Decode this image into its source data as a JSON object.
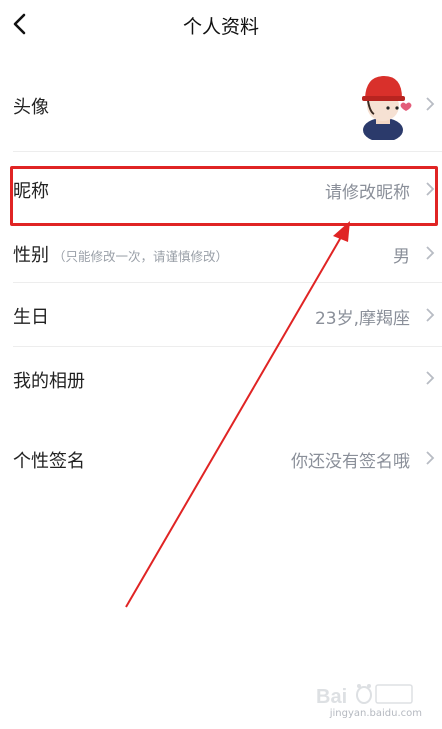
{
  "header": {
    "title": "个人资料"
  },
  "rows": {
    "avatar": {
      "label": "头像"
    },
    "nickname": {
      "label": "昵称",
      "value": "请修改昵称"
    },
    "gender": {
      "label": "性别",
      "hint": "（只能修改一次，请谨慎修改）",
      "value": "男"
    },
    "birthday": {
      "label": "生日",
      "value": "23岁,摩羯座"
    },
    "album": {
      "label": "我的相册"
    },
    "signature": {
      "label": "个性签名",
      "value": "你还没有签名哦"
    }
  },
  "watermark": {
    "text": "jingyan.baidu.com"
  },
  "colors": {
    "highlight": "#e02424",
    "value_text": "#8a8f99"
  }
}
